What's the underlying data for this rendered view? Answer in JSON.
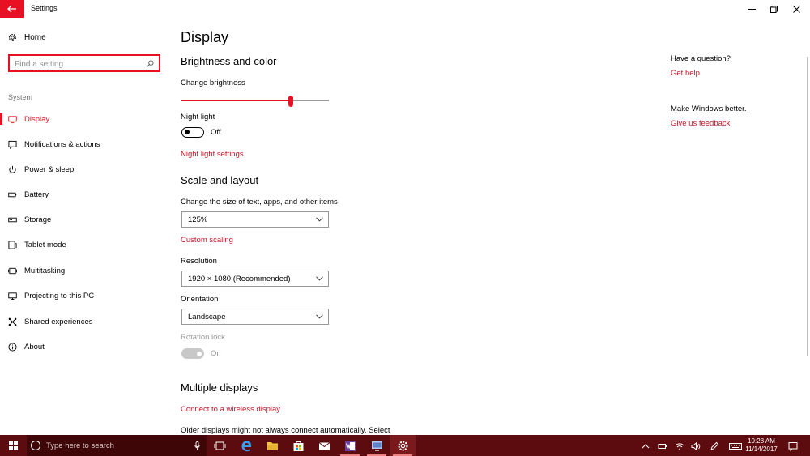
{
  "window": {
    "title": "Settings"
  },
  "sidebar": {
    "home_label": "Home",
    "search_placeholder": "Find a setting",
    "section_label": "System",
    "items": [
      {
        "label": "Display",
        "icon": "monitor-icon",
        "active": true
      },
      {
        "label": "Notifications & actions",
        "icon": "notification-icon"
      },
      {
        "label": "Power & sleep",
        "icon": "power-icon"
      },
      {
        "label": "Battery",
        "icon": "battery-icon"
      },
      {
        "label": "Storage",
        "icon": "storage-icon"
      },
      {
        "label": "Tablet mode",
        "icon": "tablet-icon"
      },
      {
        "label": "Multitasking",
        "icon": "multitasking-icon"
      },
      {
        "label": "Projecting to this PC",
        "icon": "projecting-icon"
      },
      {
        "label": "Shared experiences",
        "icon": "shared-icon"
      },
      {
        "label": "About",
        "icon": "info-icon"
      }
    ]
  },
  "main": {
    "title": "Display",
    "brightness_section": {
      "heading": "Brightness and color",
      "brightness_label": "Change brightness",
      "brightness_level": 0.74,
      "night_light_label": "Night light",
      "night_light_state": "Off",
      "night_light_settings_link": "Night light settings"
    },
    "scale_section": {
      "heading": "Scale and layout",
      "scale_label": "Change the size of text, apps, and other items",
      "scale_value": "125%",
      "custom_scaling_link": "Custom scaling",
      "resolution_label": "Resolution",
      "resolution_value": "1920 × 1080 (Recommended)",
      "orientation_label": "Orientation",
      "orientation_value": "Landscape",
      "rotation_lock_label": "Rotation lock",
      "rotation_lock_state": "On"
    },
    "multiple_displays_section": {
      "heading": "Multiple displays",
      "wireless_link": "Connect to a wireless display",
      "older_displays_text": "Older displays might not always connect automatically. Select"
    }
  },
  "rail": {
    "question": "Have a question?",
    "help_link": "Get help",
    "better": "Make Windows better.",
    "feedback_link": "Give us feedback"
  },
  "taskbar": {
    "search_placeholder": "Type here to search",
    "time": "10:28 AM",
    "date": "11/14/2017",
    "accent": "#5c0c0e"
  }
}
